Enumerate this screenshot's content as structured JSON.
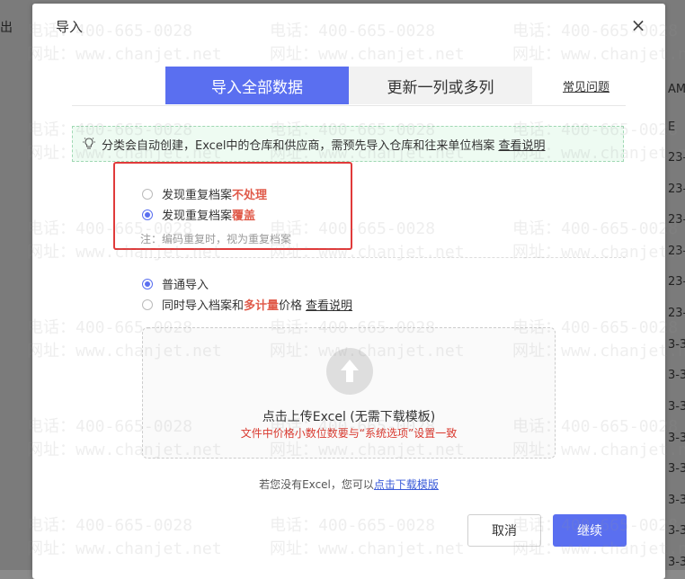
{
  "background": {
    "left_label": "出",
    "right_labels": [
      "AM",
      "E",
      "23-",
      "23-",
      "23-",
      "23-",
      "23-",
      "23-",
      "3-3",
      "3-3",
      "3-3",
      "3-3",
      "3-3",
      "3-3",
      "3-3",
      "3-3",
      "3-3"
    ]
  },
  "dialog": {
    "title": "导入",
    "close_glyph": "×"
  },
  "tabs": [
    {
      "label": "导入全部数据",
      "active": true
    },
    {
      "label": "更新一列或多列",
      "active": false
    }
  ],
  "faq_label": "常见问题",
  "tip": {
    "text": "分类会自动创建，Excel中的仓库和供应商，需预先导入仓库和往来单位档案",
    "link": "查看说明"
  },
  "duplicate_options": [
    {
      "prefix": "发现重复档案",
      "emphasis": "不处理",
      "selected": false
    },
    {
      "prefix": "发现重复档案",
      "emphasis": "覆盖",
      "selected": true
    }
  ],
  "duplicate_note": "注：编码重复时，视为重复档案",
  "import_modes": [
    {
      "label": "普通导入",
      "selected": true
    },
    {
      "prefix": "同时导入档案和",
      "emphasis": "多计量",
      "suffix": "价格",
      "link": "查看说明",
      "selected": false
    }
  ],
  "upload": {
    "title": "点击上传Excel (无需下载模板)",
    "subtitle": "文件中价格小数位数要与“系统选项”设置一致"
  },
  "no_excel": {
    "text": "若您没有Excel，您可以",
    "link": "点击下载模版"
  },
  "buttons": {
    "cancel": "取消",
    "continue": "继续"
  },
  "watermark": {
    "phone": "电话：400-665-0028",
    "site": "网址：www.chanjet.net"
  },
  "colors": {
    "primary": "#5a6ff0",
    "danger": "#e03a3a",
    "tip_bg": "#eefbf2"
  }
}
